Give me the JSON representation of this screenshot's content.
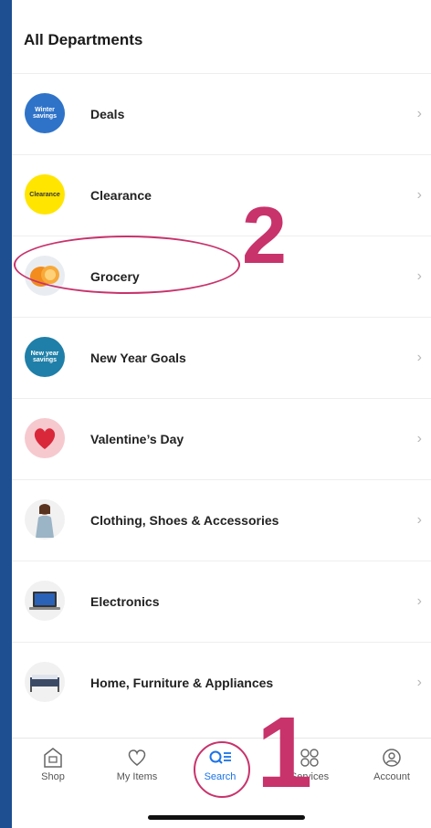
{
  "header": {
    "title": "All Departments"
  },
  "departments": [
    {
      "label": "Deals",
      "thumb_text": "Winter savings",
      "icon": "winter-savings-badge"
    },
    {
      "label": "Clearance",
      "thumb_text": "Clearance",
      "icon": "clearance-badge"
    },
    {
      "label": "Grocery",
      "icon": "orange-icon"
    },
    {
      "label": "New Year Goals",
      "thumb_text": "New year savings",
      "icon": "new-year-savings-badge"
    },
    {
      "label": "Valentine’s Day",
      "icon": "heart-icon"
    },
    {
      "label": "Clothing, Shoes & Accessories",
      "icon": "person-icon"
    },
    {
      "label": "Electronics",
      "icon": "laptop-icon"
    },
    {
      "label": "Home, Furniture & Appliances",
      "icon": "bed-icon"
    }
  ],
  "chevron": "›",
  "annotations": {
    "step_one": "1",
    "step_two": "2"
  },
  "tabbar": [
    {
      "label": "Shop",
      "icon": "shop-icon"
    },
    {
      "label": "My Items",
      "icon": "heart-outline-icon"
    },
    {
      "label": "Search",
      "icon": "search-list-icon",
      "active": true
    },
    {
      "label": "Services",
      "icon": "services-grid-icon"
    },
    {
      "label": "Account",
      "icon": "account-icon"
    }
  ],
  "colors": {
    "brand_blue": "#1d4f91",
    "annotation": "#c8336b",
    "active_tab": "#1a73e8"
  }
}
